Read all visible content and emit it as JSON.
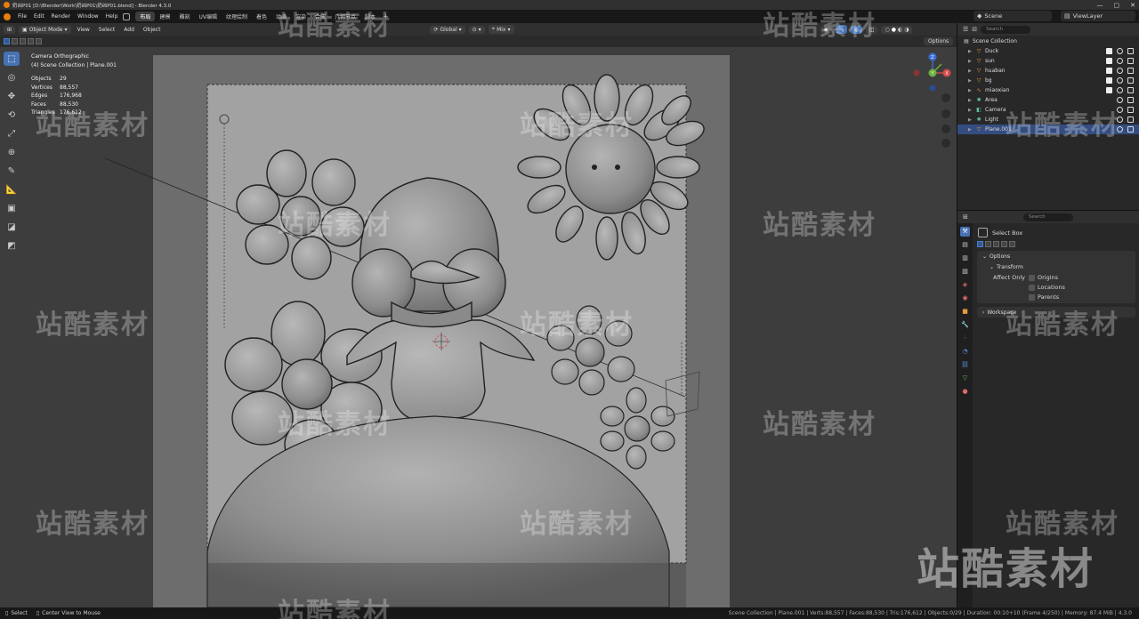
{
  "window": {
    "title": "奶凶P01 [D:\\Blender\\Work\\奶凶P01\\奶凶P01.blend] - Blender 4.3.0",
    "controls": [
      "—",
      "▢",
      "✕"
    ]
  },
  "menu": {
    "items": [
      "File",
      "Edit",
      "Render",
      "Window",
      "Help"
    ],
    "workspaces": [
      "布局",
      "建模",
      "雕刻",
      "UV编辑",
      "纹理绘制",
      "着色",
      "动画",
      "渲染",
      "合成",
      "几何节点",
      "脚本"
    ],
    "active_workspace": "布局",
    "add": "+"
  },
  "scene": {
    "label": "Scene"
  },
  "viewlayer": {
    "label": "ViewLayer"
  },
  "viewport_header": {
    "mode": "Object Mode",
    "menus": [
      "View",
      "Select",
      "Add",
      "Object"
    ],
    "orientation": "Global",
    "snap": "Mix",
    "options": "Options"
  },
  "overlay": {
    "line1": "Camera Orthographic",
    "line2": "(4) Scene Collection | Plane.001"
  },
  "stats": [
    {
      "k": "Objects",
      "v": "29"
    },
    {
      "k": "Vertices",
      "v": "88,557"
    },
    {
      "k": "Edges",
      "v": "176,968"
    },
    {
      "k": "Faces",
      "v": "88,530"
    },
    {
      "k": "Triangles",
      "v": "176,612"
    }
  ],
  "gizmo": {
    "x": "X",
    "y": "Y",
    "z": "Z"
  },
  "outliner": {
    "search_placeholder": "Search",
    "root": "Scene Collection",
    "items": [
      {
        "name": "Duck",
        "icon": "mesh-icon",
        "color": "#e89a3c"
      },
      {
        "name": "sun",
        "icon": "mesh-icon",
        "color": "#e89a3c"
      },
      {
        "name": "huaban",
        "icon": "mesh-icon",
        "color": "#e89a3c"
      },
      {
        "name": "bg",
        "icon": "mesh-icon",
        "color": "#e89a3c"
      },
      {
        "name": "miaoxian",
        "icon": "curve-icon",
        "color": "#e89a3c"
      },
      {
        "name": "Area",
        "icon": "light-icon",
        "color": "#5ec4a4"
      },
      {
        "name": "Camera",
        "icon": "camera-icon",
        "color": "#5ec4a4"
      },
      {
        "name": "Light",
        "icon": "light-icon",
        "color": "#5ec4a4"
      },
      {
        "name": "Plane.001",
        "icon": "mesh-icon",
        "color": "#5ec4a4"
      }
    ]
  },
  "properties": {
    "search_placeholder": "Search",
    "tool": "Select Box",
    "options_label": "Options",
    "transform_label": "Transform",
    "affect_only": "Affect Only",
    "checks": [
      "Origins",
      "Locations",
      "Parents"
    ],
    "workspace_label": "Workspace"
  },
  "status": {
    "left1": "Select",
    "left2": "Center View to Mouse",
    "right": "Scene Collection | Plane.001 | Verts:88,557 | Faces:88,530 | Tris:176,612 | Objects:0/29 | Duration: 00:10+10 (Frame 4/250) | Memory: 87.4 MiB | 4.3.0"
  },
  "watermark": "站酷素材"
}
